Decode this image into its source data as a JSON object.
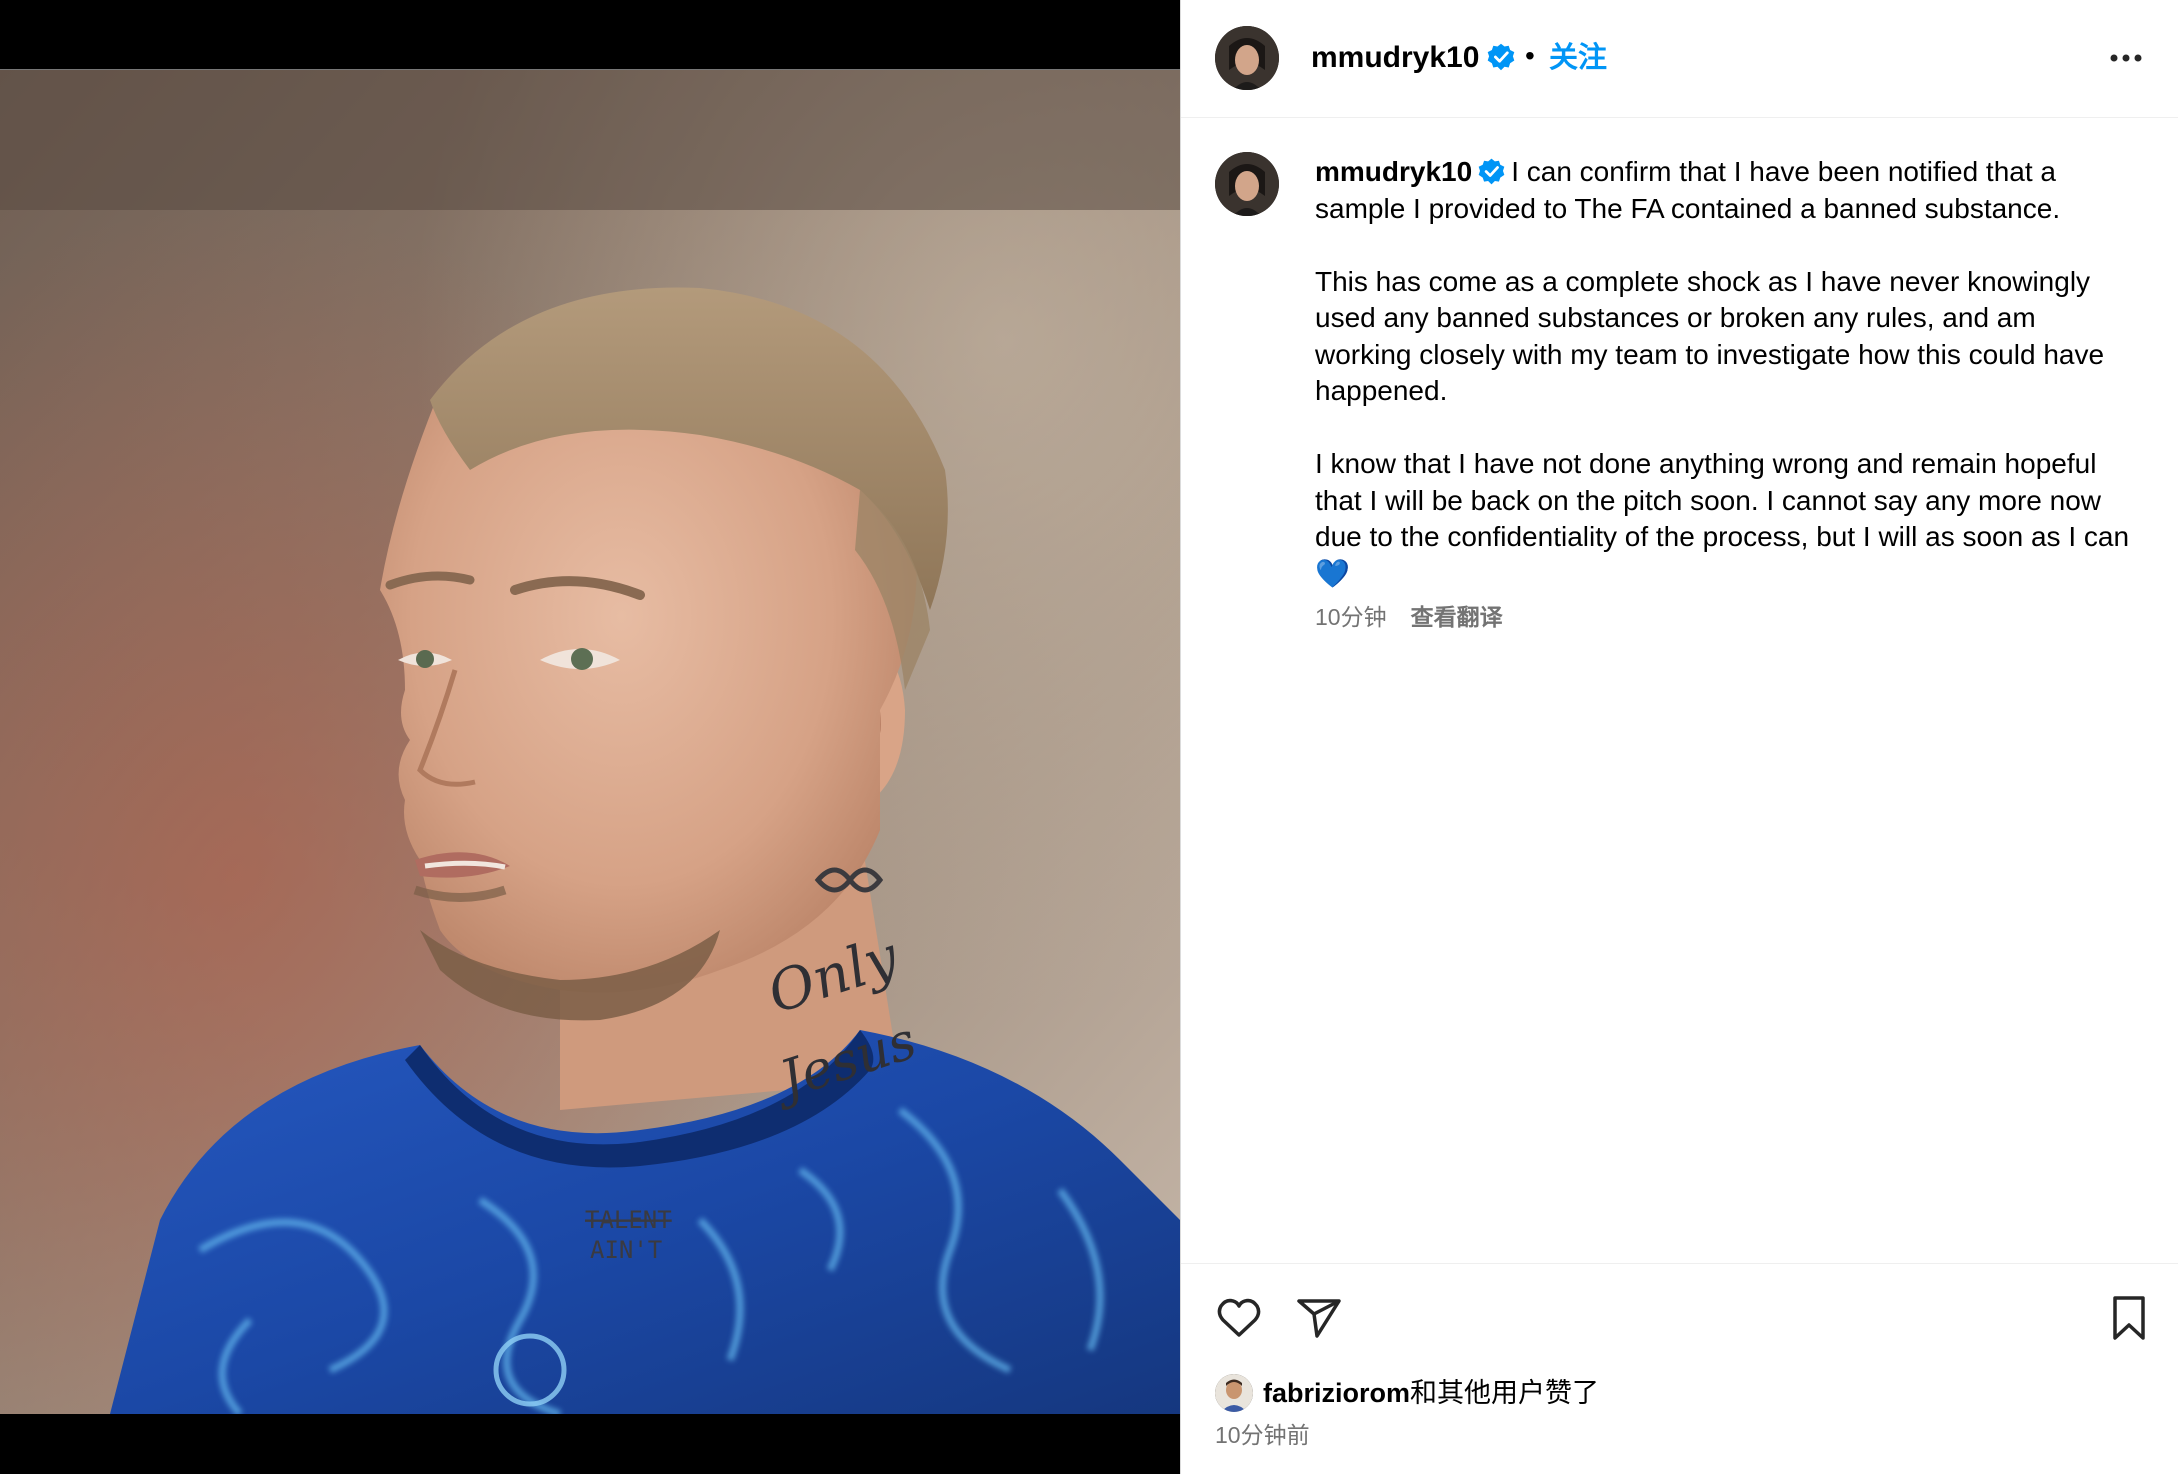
{
  "post": {
    "author": {
      "username": "mmudryk10",
      "verified": true,
      "follow_label": "关注",
      "separator": "•"
    },
    "photo": {
      "alt_description": "Footballer in blue kit",
      "neck_tattoos": [
        "Only",
        "Jesus",
        "TALENT",
        "AIN'T"
      ]
    },
    "caption": {
      "username": "mmudryk10",
      "paragraphs": [
        "I can confirm that I have been notified that a sample I provided to The FA contained a banned substance.",
        "This has come as a complete shock as I have never knowingly used any banned substances or broken any rules, and am working closely with my team to investigate how this could have happened.",
        "I know that I have not done anything wrong and remain hopeful that I will be back on the pitch soon. I cannot say any more now due to the confidentiality of the process, but I will as soon as I can💙"
      ],
      "time_ago": "10分钟",
      "translate_label": "查看翻译"
    },
    "likes": {
      "user": "fabriziorom",
      "suffix": "和其他用户赞了"
    },
    "timestamp": "10分钟前"
  },
  "icons": {
    "verified": "verified-badge-icon",
    "more": "more-options-icon",
    "like": "heart-icon",
    "share": "paper-plane-icon",
    "save": "bookmark-icon"
  },
  "colors": {
    "accent_blue": "#0095f6",
    "secondary_text": "#737373",
    "divider": "#efefef",
    "jersey_blue": "#1c4fae"
  }
}
